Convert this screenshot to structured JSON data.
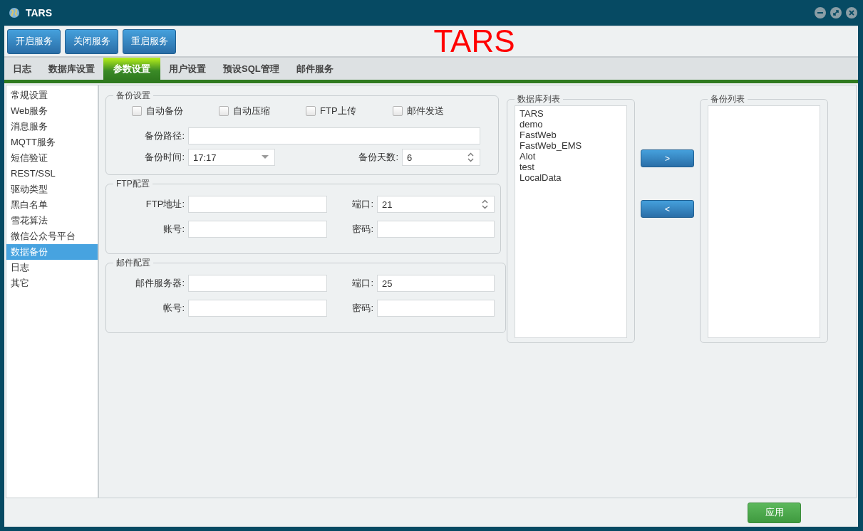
{
  "window": {
    "title": "TARS"
  },
  "toolbar": {
    "buttons": [
      "开启服务",
      "关闭服务",
      "重启服务"
    ],
    "brand": "TARS"
  },
  "tabs": [
    {
      "label": "日志",
      "selected": false
    },
    {
      "label": "数据库设置",
      "selected": false
    },
    {
      "label": "参数设置",
      "selected": true
    },
    {
      "label": "用户设置",
      "selected": false
    },
    {
      "label": "预设SQL管理",
      "selected": false
    },
    {
      "label": "邮件服务",
      "selected": false
    }
  ],
  "sidebar": {
    "items": [
      {
        "label": "常规设置",
        "selected": false
      },
      {
        "label": "Web服务",
        "selected": false
      },
      {
        "label": "消息服务",
        "selected": false
      },
      {
        "label": "MQTT服务",
        "selected": false
      },
      {
        "label": "短信验证",
        "selected": false
      },
      {
        "label": "REST/SSL",
        "selected": false
      },
      {
        "label": "驱动类型",
        "selected": false
      },
      {
        "label": "黑白名单",
        "selected": false
      },
      {
        "label": "雪花算法",
        "selected": false
      },
      {
        "label": "微信公众号平台",
        "selected": false
      },
      {
        "label": "数据备份",
        "selected": true
      },
      {
        "label": "日志",
        "selected": false
      },
      {
        "label": "其它",
        "selected": false
      }
    ]
  },
  "sections": [
    {
      "kind": "backup",
      "title": "备份设置",
      "checkboxes": [
        {
          "label": "自动备份",
          "checked": false
        },
        {
          "label": "自动压缩",
          "checked": false
        },
        {
          "label": "FTP上传",
          "checked": false
        },
        {
          "label": "邮件发送",
          "checked": false
        }
      ],
      "rows": [
        [
          {
            "label": "备份路径:",
            "kind": "text"
          }
        ],
        [
          {
            "label": "备份时间:",
            "kind": "select",
            "value": "17:17"
          },
          {
            "label": "备份天数:",
            "kind": "spinner",
            "value": "6"
          }
        ]
      ]
    },
    {
      "kind": "ftp",
      "title": "FTP配置",
      "rows": [
        [
          {
            "label": "FTP地址:",
            "kind": "text"
          },
          {
            "label": "端口:",
            "kind": "spinner",
            "value": "21"
          }
        ],
        [
          {
            "label": "账号:",
            "kind": "text"
          },
          {
            "label": "密码:",
            "kind": "text"
          }
        ]
      ]
    },
    {
      "kind": "mail",
      "title": "邮件配置",
      "rows": [
        [
          {
            "label": "邮件服务器:",
            "kind": "text"
          },
          {
            "label": "端口:",
            "kind": "text",
            "value": "25"
          }
        ],
        [
          {
            "label": "帐号:",
            "kind": "text"
          },
          {
            "label": "密码:",
            "kind": "text"
          }
        ]
      ]
    }
  ],
  "database_list": {
    "title": "数据库列表",
    "items": [
      "TARS",
      "demo",
      "FastWeb",
      "FastWeb_EMS",
      "Alot",
      "test",
      "LocalData"
    ]
  },
  "move_buttons": [
    ">",
    "<"
  ],
  "backup_list": {
    "title": "备份列表"
  },
  "apply_button": "应用"
}
